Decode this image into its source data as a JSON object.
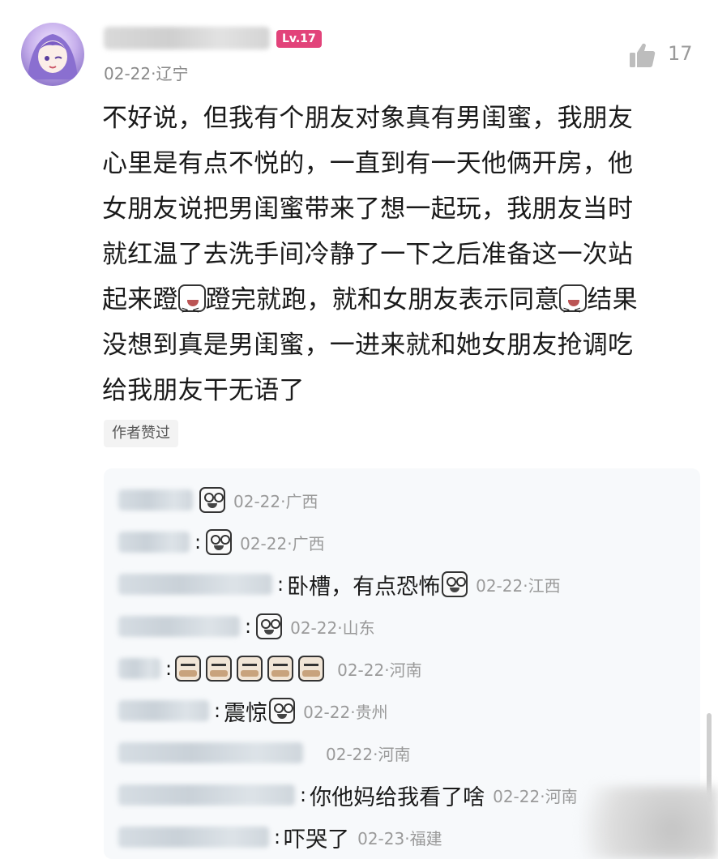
{
  "post": {
    "level": "Lv.17",
    "meta": "02-22·辽宁",
    "likes": "17",
    "body_lines": [
      [
        "不好说，但我有个朋友对象真有男闺蜜，我朋友",
        "",
        ""
      ],
      [
        "心里是有点不悦的，一直到有一天他俩开房，他",
        "",
        ""
      ],
      [
        "女朋友说把男闺蜜带来了想一起玩，我朋友当时",
        "",
        ""
      ],
      [
        "就红温了去洗手间冷静了一下之后准备这一次站",
        "",
        ""
      ],
      [
        "起来蹬",
        "蹬完就跑，就和女朋友表示同意",
        "结果"
      ],
      [
        "没想到真是男闺蜜，一进来就和她女朋友抢调吃",
        "",
        ""
      ],
      [
        "给我朋友干无语了",
        "",
        ""
      ]
    ],
    "author_liked": "作者赞过"
  },
  "replies": [
    {
      "text": "",
      "meta": "02-22·广西"
    },
    {
      "text": "",
      "meta": "02-22·广西"
    },
    {
      "text": "卧槽，有点恐怖",
      "meta": "02-22·江西"
    },
    {
      "text": "",
      "meta": "02-22·山东"
    },
    {
      "text": "",
      "meta": "02-22·河南"
    },
    {
      "text": "震惊",
      "meta": "02-22·贵州"
    },
    {
      "text": "",
      "meta": "02-22·河南"
    },
    {
      "text": "你他妈给我看了啥",
      "meta": "02-22·河南"
    },
    {
      "text": "吓哭了",
      "meta": "02-23·福建"
    }
  ],
  "icons": {
    "like": "thumbs-up-icon",
    "reaction": "goggle-eyes-face-icon",
    "laugh": "laughing-face-icon",
    "meme": "meme-face-icon"
  }
}
